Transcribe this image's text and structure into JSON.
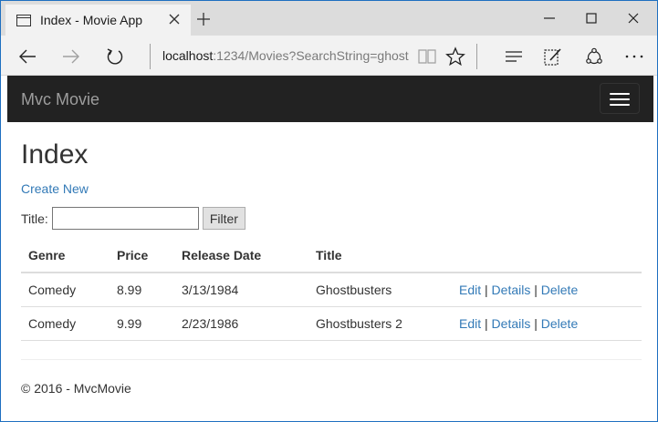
{
  "browser": {
    "tab_title": "Index - Movie App",
    "url_host": "localhost",
    "url_path": ":1234/Movies?SearchString=ghost"
  },
  "site": {
    "brand": "Mvc Movie"
  },
  "page": {
    "heading": "Index",
    "create_new": "Create New",
    "filter_label": "Title:",
    "filter_value": "",
    "filter_button": "Filter"
  },
  "table": {
    "headers": [
      "Genre",
      "Price",
      "Release Date",
      "Title"
    ],
    "rows": [
      {
        "genre": "Comedy",
        "price": "8.99",
        "release_date": "3/13/1984",
        "title": "Ghostbusters",
        "edit": "Edit",
        "details": "Details",
        "delete": "Delete"
      },
      {
        "genre": "Comedy",
        "price": "9.99",
        "release_date": "2/23/1986",
        "title": "Ghostbusters 2",
        "edit": "Edit",
        "details": "Details",
        "delete": "Delete"
      }
    ],
    "separator": "|"
  },
  "footer": {
    "text": "© 2016 - MvcMovie"
  },
  "colors": {
    "link": "#337ab7",
    "navbar_bg": "#222222",
    "brand": "#9d9d9d",
    "window_border": "#1e6fc0"
  },
  "icons": [
    "page-icon",
    "close-icon",
    "plus-icon",
    "minimize-icon",
    "maximize-icon",
    "back-arrow-icon",
    "forward-arrow-icon",
    "refresh-icon",
    "reading-view-icon",
    "favorite-star-icon",
    "hub-icon",
    "web-note-icon",
    "share-icon",
    "more-icon",
    "hamburger-icon"
  ]
}
